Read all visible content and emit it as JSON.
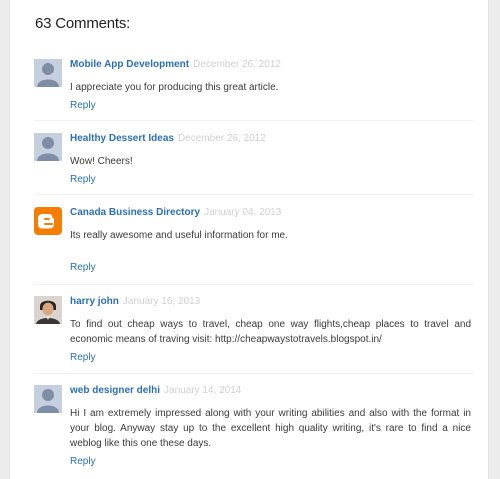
{
  "comments_header": {
    "title": "63 Comments:"
  },
  "colors": {
    "link": "#2a6fb8",
    "date": "#d0d0d0",
    "blogger": "#f57d00"
  },
  "comments": [
    {
      "author": "Mobile App Development",
      "date": "December 26, 2012",
      "avatar": "default-person-icon",
      "text": "I appreciate you for producing this great article.",
      "reply_label": "Reply"
    },
    {
      "author": "Healthy Dessert Ideas",
      "date": "December 26, 2012",
      "avatar": "default-person-icon",
      "text": "Wow! Cheers!",
      "reply_label": "Reply"
    },
    {
      "author": "Canada Business Directory",
      "date": "January 04, 2013",
      "avatar": "blogger-icon",
      "text": "Its really awesome and useful information for me.",
      "reply_label": "Reply"
    },
    {
      "author": "harry john",
      "date": "January 16, 2013",
      "avatar": "profile-photo",
      "text": "To find out cheap ways to travel, cheap one way flights,cheap places to travel and economic means of traving visit: http://cheapwaystotravels.blogspot.in/",
      "reply_label": "Reply"
    },
    {
      "author": "web designer delhi",
      "date": "January 14, 2014",
      "avatar": "default-person-icon",
      "text": "Hi I am extremely impressed along with your writing abilities and also with the format in your blog. Anyway stay up to the excellent high quality writing, it's rare to find a nice weblog like this one these days.",
      "reply_label": "Reply"
    }
  ]
}
